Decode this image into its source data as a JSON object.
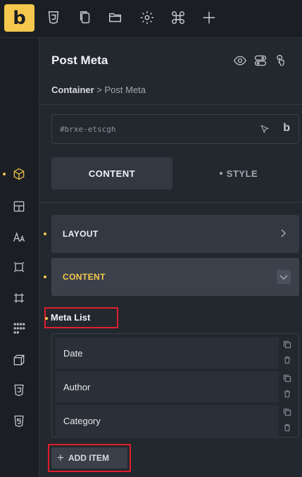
{
  "toolbar": {
    "logo": "b",
    "icons": [
      "css3-icon",
      "pages-icon",
      "folder-icon",
      "settings-icon",
      "command-icon",
      "plus-icon"
    ]
  },
  "rail": {
    "icons": [
      "box-icon",
      "layout-icon",
      "typography-icon",
      "frame-icon",
      "crop-icon",
      "grid-dots-icon",
      "cube-icon",
      "css3-icon",
      "html5-icon"
    ]
  },
  "panel": {
    "title": "Post Meta",
    "breadcrumb_parent": "Container",
    "breadcrumb_sep": " > ",
    "breadcrumb_current": "Post Meta",
    "element_id": "#brxe-etscgh",
    "id_b": "b",
    "tabs": {
      "content": "CONTENT",
      "style": "STYLE"
    },
    "groups": {
      "layout": "LAYOUT",
      "content": "CONTENT"
    },
    "meta_list_label": "Meta List",
    "meta_items": [
      "Date",
      "Author",
      "Category"
    ],
    "add_item": "ADD ITEM"
  },
  "colors": {
    "accent": "#f5c74d",
    "highlight": "#e01e2a",
    "bg": "#23272e"
  }
}
